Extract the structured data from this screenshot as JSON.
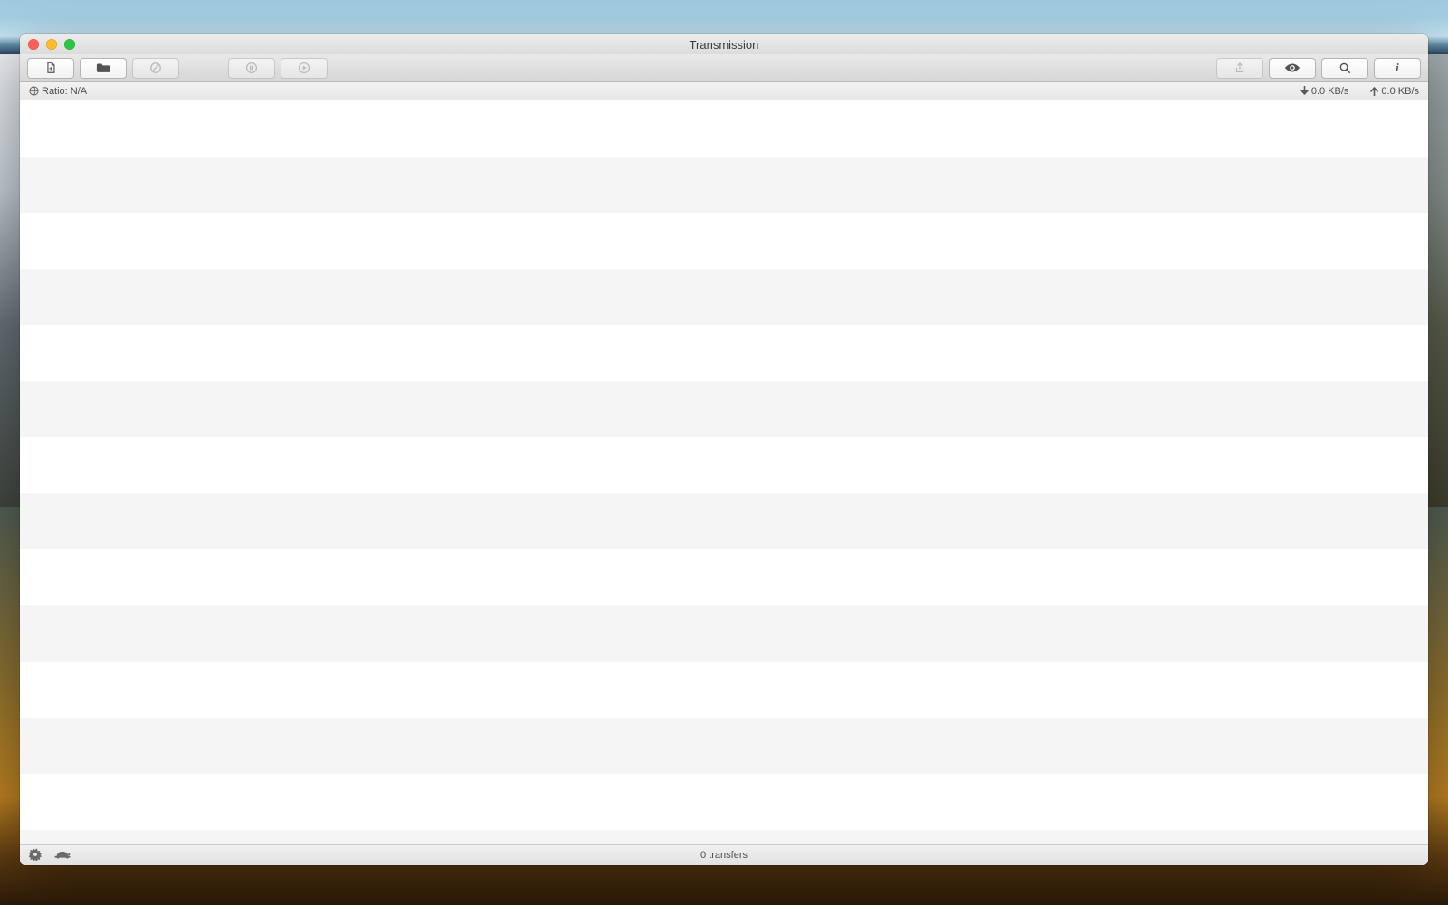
{
  "window": {
    "title": "Transmission"
  },
  "toolbar": {
    "icons": {
      "create": "create-torrent-icon",
      "open": "open-folder-icon",
      "remove": "remove-icon",
      "pause": "pause-icon",
      "resume": "resume-icon",
      "share": "share-icon",
      "quicklook": "quicklook-icon",
      "search": "search-icon",
      "info": "info-icon"
    }
  },
  "status": {
    "ratio_label": "Ratio: N/A",
    "download_speed": "0.0 KB/s",
    "upload_speed": "0.0 KB/s"
  },
  "bottom": {
    "transfers_label": "0 transfers"
  },
  "stripes": {
    "row_count": 14
  }
}
